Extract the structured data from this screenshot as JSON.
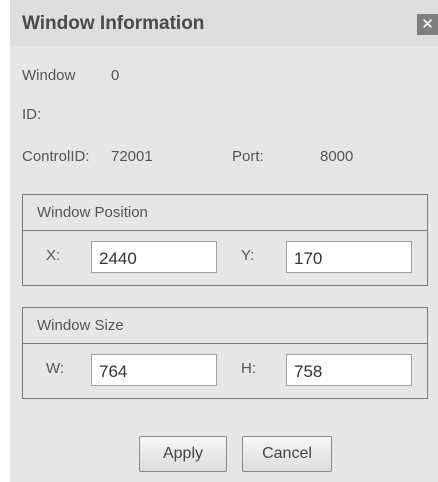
{
  "dialog": {
    "title": "Window Information",
    "close_glyph": "✕",
    "close_icon": "close-icon"
  },
  "info": {
    "window_label": "Window",
    "window_value": "0",
    "id_label": "ID:",
    "control_id_label": "ControlID:",
    "control_id_value": "72001",
    "port_label": "Port:",
    "port_value": "8000"
  },
  "position": {
    "title": "Window Position",
    "x_label": "X:",
    "x_value": "2440",
    "y_label": "Y:",
    "y_value": "170"
  },
  "size": {
    "title": "Window Size",
    "w_label": "W:",
    "w_value": "764",
    "h_label": "H:",
    "h_value": "758"
  },
  "buttons": {
    "apply_label": "Apply",
    "cancel_label": "Cancel"
  }
}
